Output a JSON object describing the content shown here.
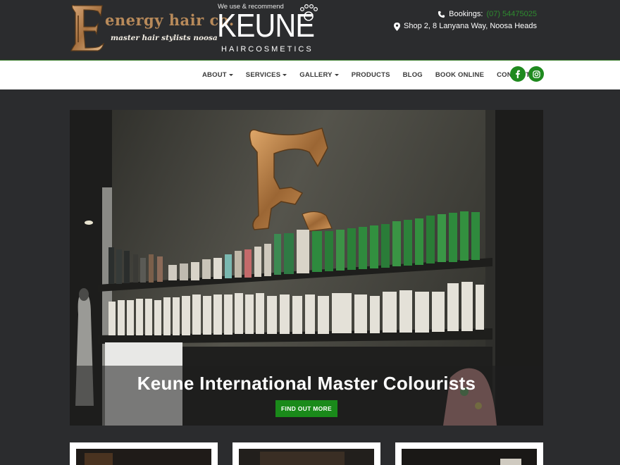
{
  "header": {
    "logo": {
      "brand": "energy hair co.",
      "tagline": "master hair stylists noosa"
    },
    "partner": {
      "prefix": "We use & recommend",
      "wordmark": "KEUNE",
      "sub": "HAIRCOSMETICS"
    },
    "contact": {
      "bookings_label": "Bookings:",
      "phone": "(07) 54475025",
      "address": "Shop 2, 8 Lanyana Way, Noosa Heads"
    }
  },
  "nav": {
    "items": [
      {
        "label": "ABOUT",
        "dropdown": true
      },
      {
        "label": "SERVICES",
        "dropdown": true
      },
      {
        "label": "GALLERY",
        "dropdown": true
      },
      {
        "label": "PRODUCTS",
        "dropdown": false
      },
      {
        "label": "BLOG",
        "dropdown": false
      },
      {
        "label": "BOOK ONLINE",
        "dropdown": false
      },
      {
        "label": "CONTACT",
        "dropdown": false
      }
    ],
    "social": [
      {
        "icon": "facebook-icon",
        "color": "#1f8a1f"
      },
      {
        "icon": "instagram-icon",
        "color": "#1f8a1f"
      }
    ]
  },
  "hero": {
    "title": "Keune International Master Colourists",
    "button_label": "FIND OUT MORE"
  },
  "colors": {
    "background": "#2b2c2e",
    "accent_green": "#1f8a1f",
    "nav_bg": "#ffffff"
  }
}
